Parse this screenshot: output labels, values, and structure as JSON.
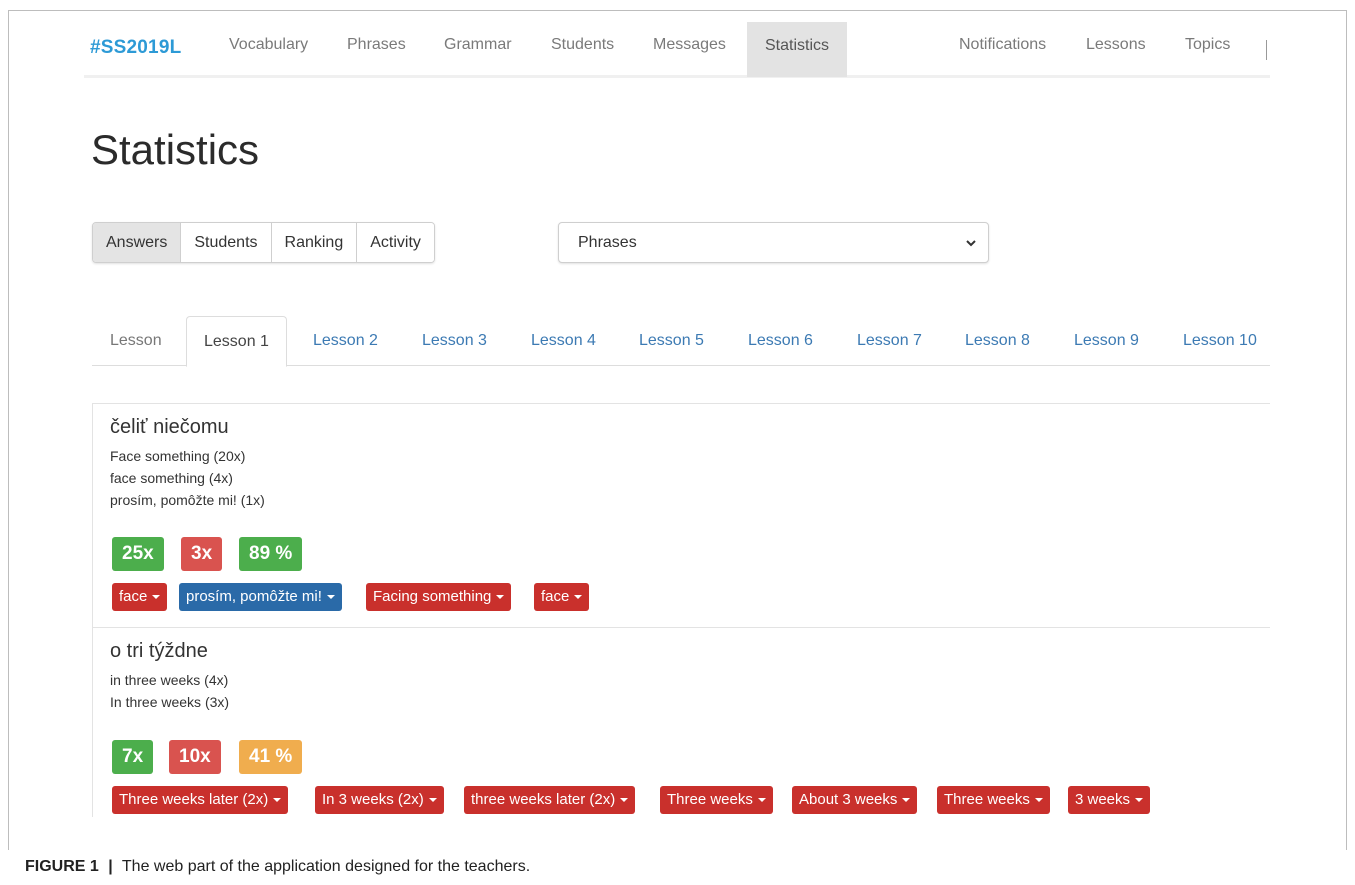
{
  "navbar": {
    "brand": "#SS2019L",
    "items": [
      "Vocabulary",
      "Phrases",
      "Grammar",
      "Students",
      "Messages",
      "Statistics",
      "Notifications",
      "Lessons",
      "Topics"
    ],
    "active": "Statistics"
  },
  "page": {
    "title": "Statistics"
  },
  "view_buttons": {
    "items": [
      "Answers",
      "Students",
      "Ranking",
      "Activity"
    ],
    "active": "Answers"
  },
  "category_select": {
    "value": "Phrases"
  },
  "lesson_tabs": {
    "items": [
      "Lesson",
      "Lesson 1",
      "Lesson 2",
      "Lesson 3",
      "Lesson 4",
      "Lesson 5",
      "Lesson 6",
      "Lesson 7",
      "Lesson 8",
      "Lesson 9",
      "Lesson 10"
    ],
    "active": "Lesson 1"
  },
  "entries": [
    {
      "term": "čeliť niečomu",
      "answers": [
        "Face something (20x)",
        "face something (4x)",
        "prosím, pomôžte mi! (1x)"
      ],
      "stats": {
        "correct": "25x",
        "wrong": "3x",
        "percent": "89 %"
      },
      "wrong_answers": [
        {
          "text": "face",
          "color": "red"
        },
        {
          "text": "prosím, pomôžte mi!",
          "color": "blue"
        },
        {
          "text": "Facing something",
          "color": "red"
        },
        {
          "text": "face",
          "color": "red"
        }
      ]
    },
    {
      "term": "o tri týždne",
      "answers": [
        "in three weeks (4x)",
        "In three weeks (3x)"
      ],
      "stats": {
        "correct": "7x",
        "wrong": "10x",
        "percent": "41 %"
      },
      "wrong_answers": [
        {
          "text": "Three weeks later (2x)",
          "color": "red"
        },
        {
          "text": "In 3 weeks (2x)",
          "color": "red"
        },
        {
          "text": "three weeks later (2x)",
          "color": "red"
        },
        {
          "text": "Three weeks",
          "color": "red"
        },
        {
          "text": "About 3 weeks",
          "color": "red"
        },
        {
          "text": "Three weeks",
          "color": "red"
        },
        {
          "text": "3 weeks",
          "color": "red"
        }
      ]
    }
  ],
  "caption": {
    "label": "FIGURE 1",
    "separator": "|",
    "text": "The web part of the application designed for the teachers."
  },
  "colors": {
    "brand": "#2d9ad6",
    "link": "#3c7ab3",
    "success": "#4cae4c",
    "danger": "#d9534f",
    "warning": "#f0ad4e",
    "info_dark": "#2a6aa8"
  }
}
